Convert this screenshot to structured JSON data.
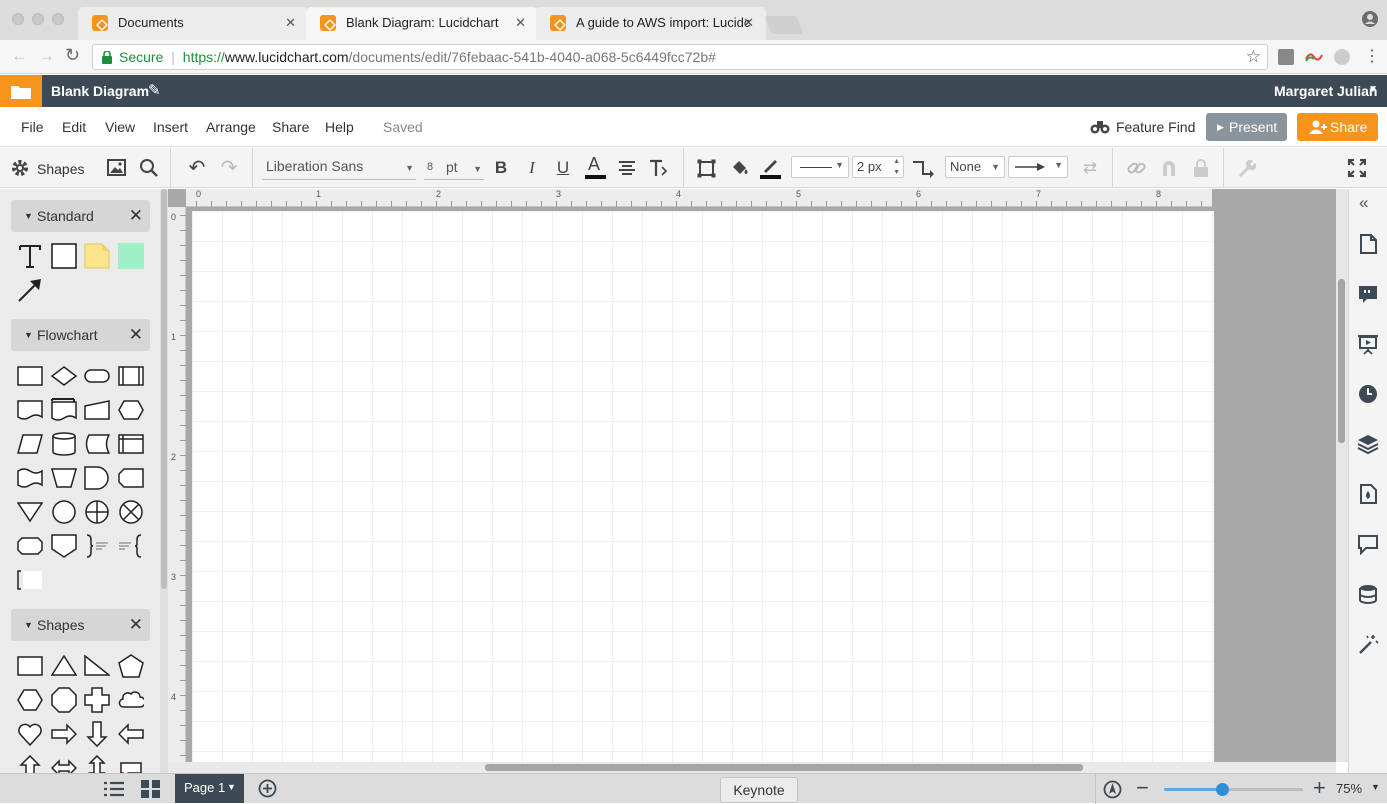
{
  "browser": {
    "tabs": [
      {
        "title": "Documents"
      },
      {
        "title": "Blank Diagram: Lucidchart"
      },
      {
        "title": "A guide to AWS import: Lucidc"
      }
    ],
    "secure_label": "Secure",
    "url_scheme": "https://",
    "url_host": "www.lucidchart.com",
    "url_path": "/documents/edit/76febaac-541b-4040-a068-5c6449fcc72b#"
  },
  "app": {
    "doc_title": "Blank Diagram",
    "user_name": "Margaret Julian"
  },
  "menubar": {
    "items": [
      "File",
      "Edit",
      "View",
      "Insert",
      "Arrange",
      "Share",
      "Help"
    ],
    "status": "Saved",
    "feature_find": "Feature Find",
    "present": "Present",
    "share": "Share"
  },
  "toolbar": {
    "shapes_label": "Shapes",
    "font_family": "Liberation Sans",
    "font_size": "8",
    "font_unit": "pt",
    "line_width": "2 px",
    "line_end": "None"
  },
  "panel": {
    "sections": [
      "Standard",
      "Flowchart",
      "Shapes"
    ]
  },
  "rulers": {
    "top": [
      "0",
      "1",
      "2",
      "3",
      "4",
      "5",
      "6",
      "7",
      "8"
    ],
    "left": [
      "0",
      "1",
      "2",
      "3",
      "4"
    ]
  },
  "bottombar": {
    "page_tab": "Page 1",
    "keynote": "Keynote",
    "zoom": "75%",
    "zoom_level": 0.42
  },
  "colors": {
    "accent": "#f7941d",
    "header": "#3d4a56",
    "present": "#8a949c",
    "shape_yellow": "#fde58d",
    "shape_green": "#9ef0c8"
  }
}
